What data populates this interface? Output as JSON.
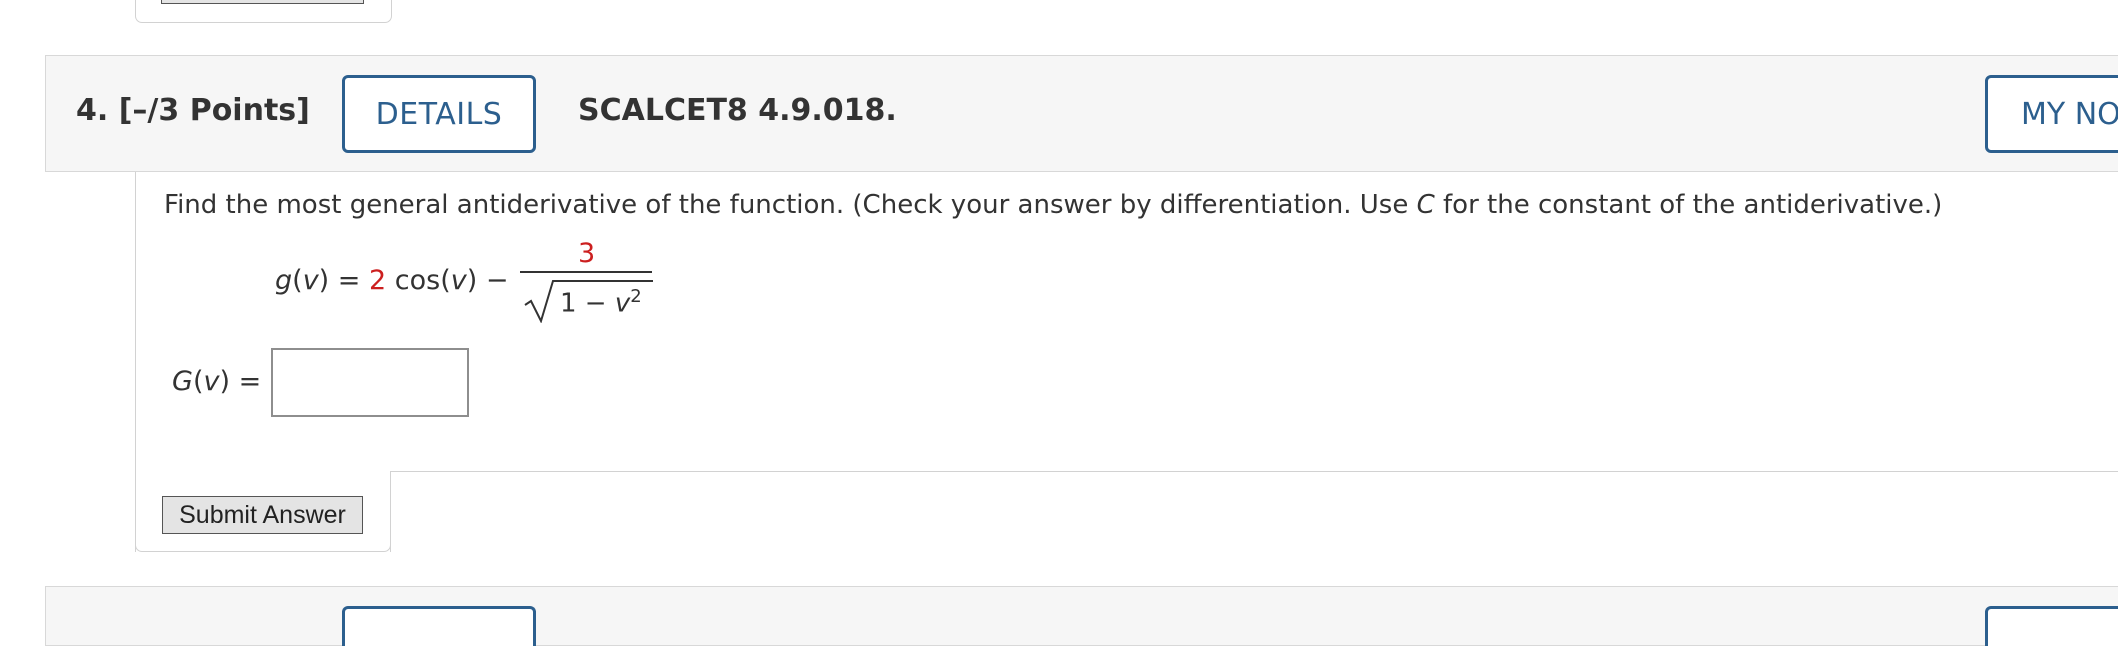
{
  "question": {
    "number_points": "4.  [–/3 Points]",
    "details_label": "DETAILS",
    "code": "SCALCET8 4.9.018.",
    "my_notes_label": "MY NOTES",
    "instructions_pre": "Find the most general antiderivative of the function. (Check your answer by differentiation. Use ",
    "instructions_var": "C",
    "instructions_post": " for the constant of the antiderivative.)",
    "function": {
      "lhs_name": "g",
      "lhs_var": "v",
      "coefficient": "2",
      "trig": "cos",
      "trig_var": "v",
      "minus": "−",
      "numerator": "3",
      "denominator_base": "1 − ",
      "denominator_var": "v",
      "denominator_exp": "2"
    },
    "answer": {
      "label_name": "G",
      "label_var": "v",
      "value": "",
      "placeholder": ""
    },
    "submit_label": "Submit Answer"
  },
  "colors": {
    "accent": "#2c5f8e",
    "highlight_red": "#cc1f1f",
    "header_bg": "#f6f6f6",
    "text": "#333333"
  }
}
